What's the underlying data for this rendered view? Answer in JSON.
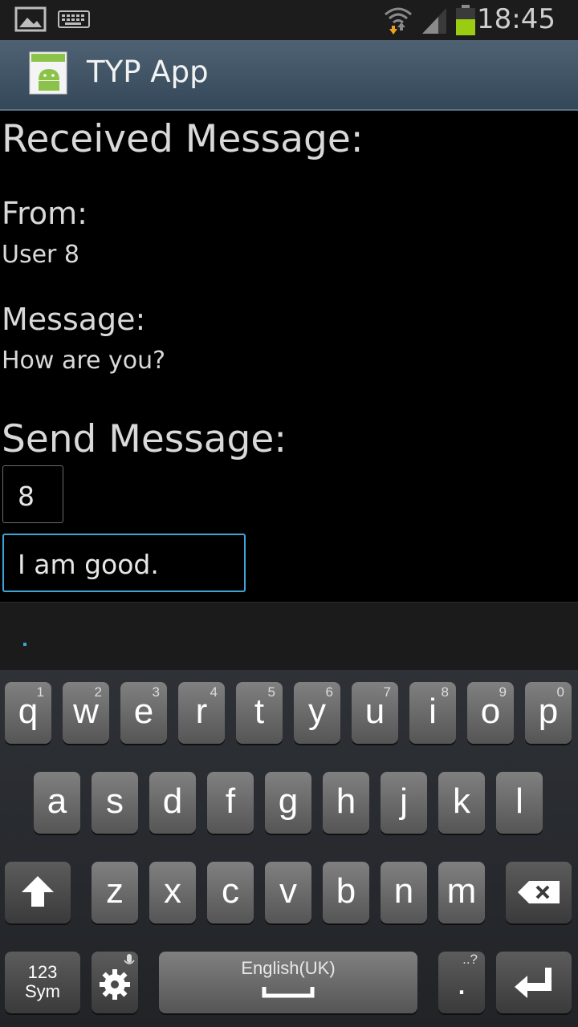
{
  "status_bar": {
    "time": "18:45"
  },
  "app": {
    "title": "TYP App"
  },
  "received": {
    "heading": "Received Message:",
    "from_label": "From:",
    "from_value": "User 8",
    "message_label": "Message:",
    "message_value": "How are you?"
  },
  "send": {
    "heading": "Send Message:",
    "recipient_value": "8",
    "message_value": "I am good."
  },
  "keyboard": {
    "row1": [
      {
        "k": "q",
        "n": "1"
      },
      {
        "k": "w",
        "n": "2"
      },
      {
        "k": "e",
        "n": "3"
      },
      {
        "k": "r",
        "n": "4"
      },
      {
        "k": "t",
        "n": "5"
      },
      {
        "k": "y",
        "n": "6"
      },
      {
        "k": "u",
        "n": "7"
      },
      {
        "k": "i",
        "n": "8"
      },
      {
        "k": "o",
        "n": "9"
      },
      {
        "k": "p",
        "n": "0"
      }
    ],
    "row2": [
      "a",
      "s",
      "d",
      "f",
      "g",
      "h",
      "j",
      "k",
      "l"
    ],
    "row3": [
      "z",
      "x",
      "c",
      "v",
      "b",
      "n",
      "m"
    ],
    "sym_line1": "123",
    "sym_line2": "Sym",
    "space_label": "English(UK)",
    "period_label": ".",
    "period_hint": "..?"
  }
}
